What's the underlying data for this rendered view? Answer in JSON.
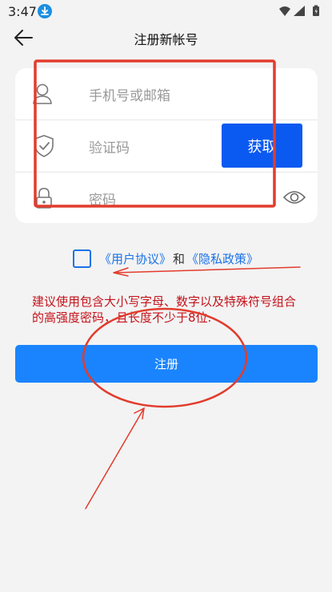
{
  "status": {
    "time": "3:47",
    "download_icon": "download-icon",
    "wifi_icon": "wifi-icon",
    "signal_icon": "signal-icon",
    "battery_icon": "battery-icon"
  },
  "header": {
    "title": "注册新帐号",
    "back_icon": "back-arrow-icon"
  },
  "form": {
    "account": {
      "placeholder": "手机号或邮箱",
      "icon": "user-icon"
    },
    "code": {
      "placeholder": "验证码",
      "icon": "shield-check-icon",
      "button_label": "获取"
    },
    "password": {
      "placeholder": "密码",
      "icon": "lock-icon",
      "toggle_icon": "eye-icon"
    }
  },
  "consent": {
    "user_agreement": "《用户协议》",
    "and": "和",
    "privacy_policy": "《隐私政策》"
  },
  "hint": "建议使用包含大小写字母、数字以及特殊符号组合的高强度密码，且长度不少于8位.",
  "submit_label": "注册",
  "colors": {
    "primary": "#1a84ff",
    "code_button": "#0a59f0",
    "hint": "#c4131b",
    "annotation": "#e23c2d"
  }
}
